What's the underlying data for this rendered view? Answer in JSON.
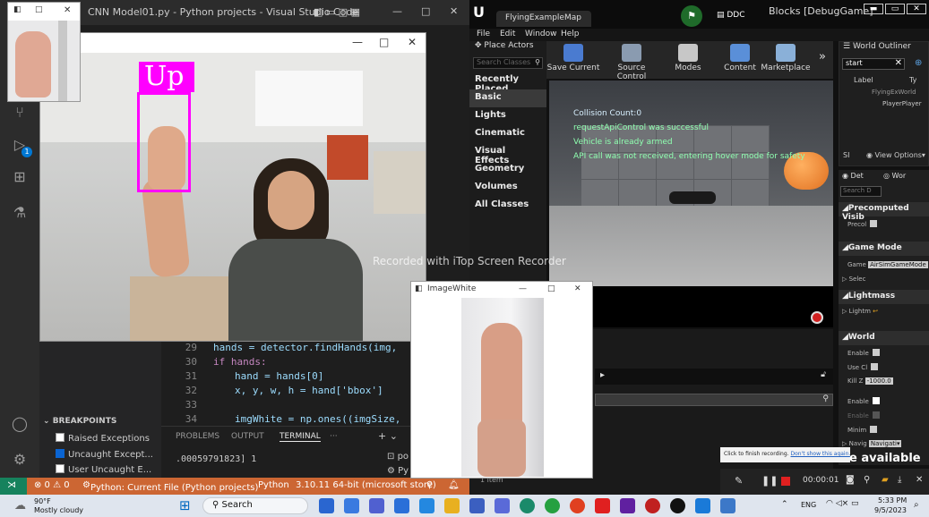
{
  "vscode": {
    "title": "CNN Model01.py - Python projects - Visual Studio Code",
    "win_controls": [
      "—",
      "□",
      "✕"
    ],
    "activity_badge": "1",
    "editor": {
      "lines": [
        {
          "num": "29",
          "text": "hands = detector.findHands(img,"
        },
        {
          "num": "30",
          "text": "if hands:"
        },
        {
          "num": "31",
          "text": "hand = hands[0]"
        },
        {
          "num": "32",
          "text": "x, y, w, h = hand['bbox']"
        },
        {
          "num": "33",
          "text": ""
        },
        {
          "num": "34",
          "text": "imgWhite = np.ones((imgSize,"
        }
      ]
    },
    "breakpoints": {
      "header": "BREAKPOINTS",
      "items": [
        {
          "label": "Raised Exceptions",
          "checked": false
        },
        {
          "label": "Uncaught Except...",
          "checked": true
        },
        {
          "label": "User Uncaught E...",
          "checked": false
        }
      ]
    },
    "panel": {
      "tabs": [
        "PROBLEMS",
        "OUTPUT",
        "TERMINAL",
        "···"
      ],
      "active_tab": "TERMINAL",
      "output_line": ".00059791823] 1",
      "side_items": [
        "po",
        "Py"
      ]
    },
    "status": {
      "errors": "⊗ 0 ⚠ 0",
      "debug": "Python: Current File (Python projects)",
      "language": "Python",
      "interpreter": "3.10.11 64-bit (microsoft store)"
    }
  },
  "camera_window": {
    "label": "Up",
    "win_controls": [
      "—",
      "□",
      "✕"
    ]
  },
  "watermark": "Recorded with iTop Screen Recorder",
  "imagewhite_window": {
    "title": "ImageWhite",
    "win_controls": [
      "—",
      "□",
      "✕"
    ]
  },
  "unreal": {
    "tab_title": "FlyingExampleMap",
    "ddc": "DDC",
    "blocks_title": "Blocks [DebugGame]",
    "menu": [
      "File",
      "Edit",
      "Window",
      "Help"
    ],
    "place_actors": "Place Actors",
    "search_classes_placeholder": "Search Classes",
    "categories": [
      "Recently Placed",
      "Basic",
      "Lights",
      "Cinematic",
      "Visual Effects",
      "Geometry",
      "Volumes",
      "All Classes"
    ],
    "toolbar": [
      "Save Current",
      "Source Control",
      "Modes",
      "Content",
      "Marketplace"
    ],
    "messages": [
      {
        "text": "Collision Count:0",
        "color": "#d8f0ff"
      },
      {
        "text": "requestApiControl was successful",
        "color": "#8fffb0"
      },
      {
        "text": "Vehicle is already armed",
        "color": "#8fffb0"
      },
      {
        "text": "API call was not received, entering hover mode for safety",
        "color": "#8fffb0"
      }
    ],
    "outliner": {
      "title": "World Outliner",
      "search_value": "start",
      "col_label": "Label",
      "col_type": "Ty",
      "rows": [
        "FlyingExWorld",
        "PlayerPlayer"
      ],
      "view_options": "View Options▾",
      "count_prefix": "SI"
    },
    "details_tabs": [
      "Det",
      "Wor"
    ],
    "details_search": "Search D",
    "sections": [
      {
        "title": "Precomputed Visib",
        "props": [
          {
            "label": "Precol",
            "type": "checkbox"
          }
        ]
      },
      {
        "title": "Game Mode",
        "props": [
          {
            "label": "Game",
            "value": "AirSimGameMode"
          },
          {
            "label": "Selec",
            "type": "expander"
          }
        ]
      },
      {
        "title": "Lightmass",
        "props": [
          {
            "label": "Lightm",
            "type": "reset"
          }
        ]
      },
      {
        "title": "World",
        "props": [
          {
            "label": "Enable",
            "type": "checkbox"
          },
          {
            "label": "Use Cl",
            "type": "checkbox"
          },
          {
            "label": "Kill Z",
            "value": "-1000.0"
          },
          {
            "label": "Enable",
            "type": "checkbox_on"
          },
          {
            "label": "Enable",
            "type": "checkbox"
          },
          {
            "label": "Minim",
            "type": "checkbox"
          },
          {
            "label": "Navig",
            "value": "Navigati▾"
          }
        ]
      }
    ],
    "content_count": "1 item",
    "notice": "Click to finish recording.",
    "notice_link": "Don't show this again.",
    "available_text": "e available",
    "rec_time": "00:00:01"
  },
  "taskbar": {
    "weather_temp": "90°F",
    "weather_desc": "Mostly cloudy",
    "search": "Search",
    "lang": "ENG",
    "time": "5:33 PM",
    "date": "9/5/2023"
  }
}
